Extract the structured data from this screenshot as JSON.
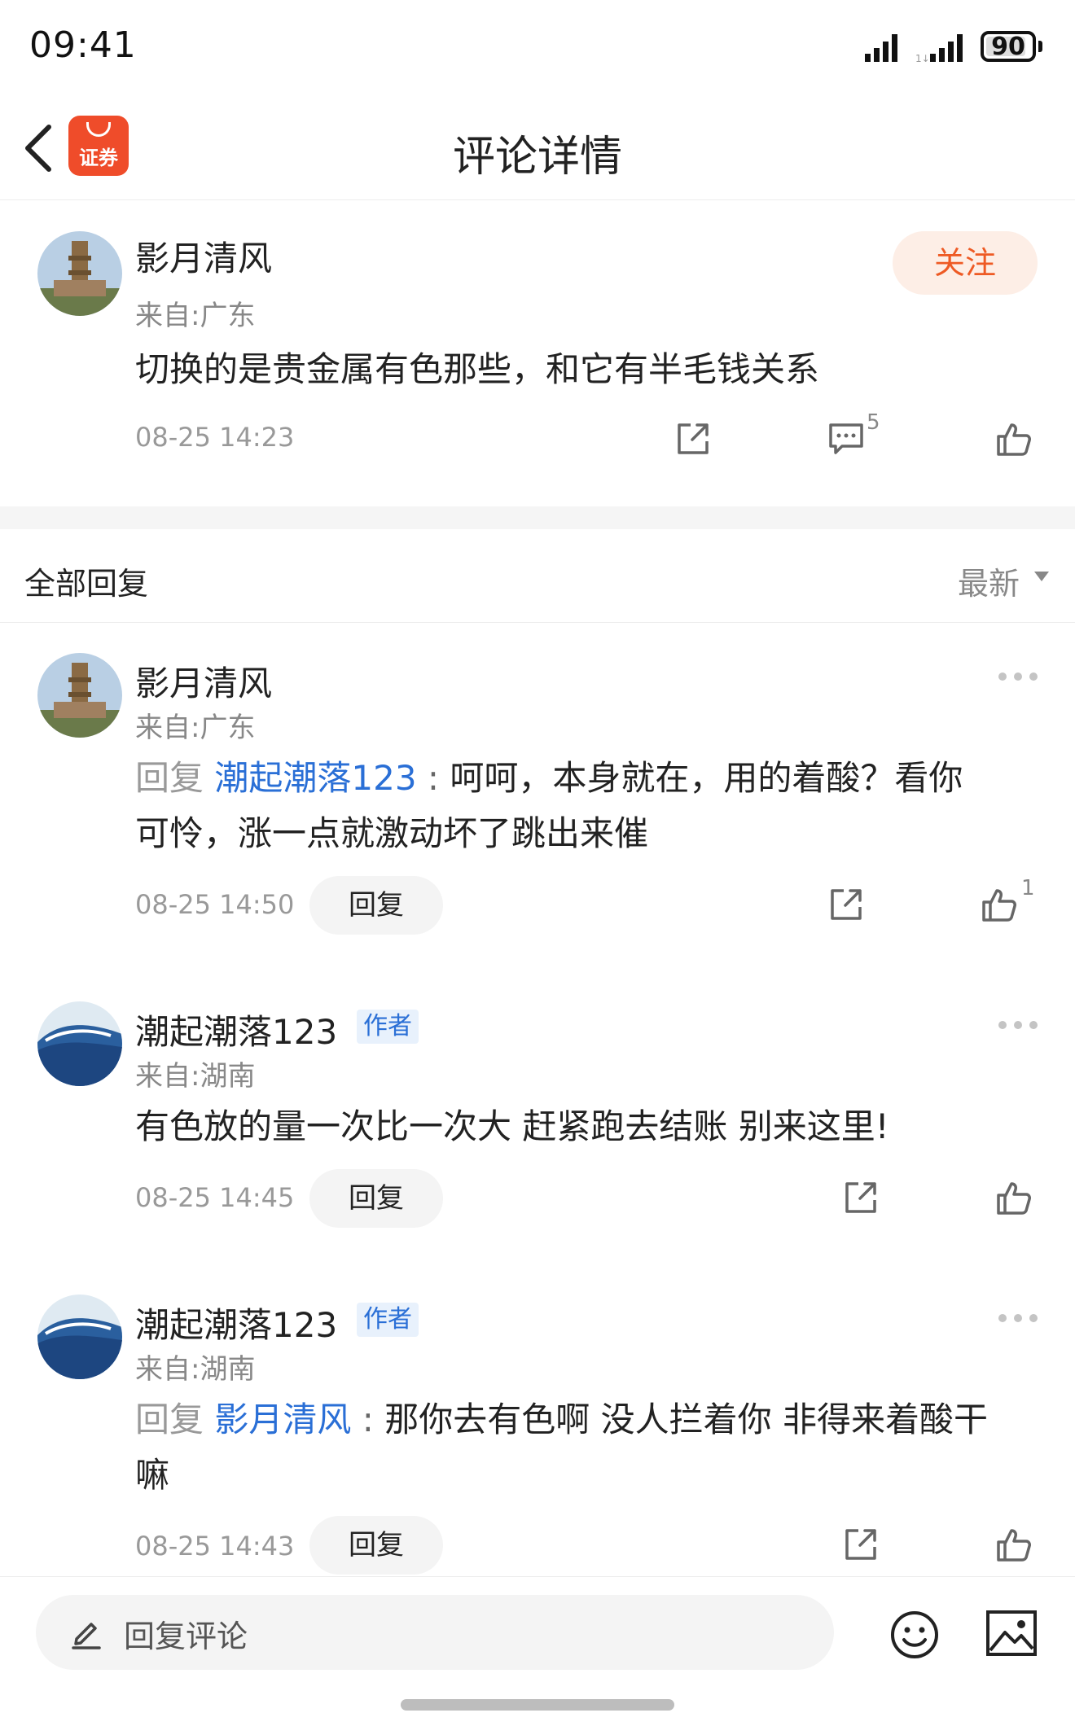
{
  "status_bar": {
    "time": "09:41",
    "battery": "90"
  },
  "nav": {
    "title": "评论详情",
    "app_logo_text": "证券"
  },
  "main_comment": {
    "username": "影月清风",
    "location": "来自:广东",
    "content": "切换的是贵金属有色那些，和它有半毛钱关系",
    "timestamp": "08-25 14:23",
    "comment_count": "5",
    "follow_label": "关注"
  },
  "replies_header": {
    "title": "全部回复",
    "sort_label": "最新"
  },
  "replies": [
    {
      "username": "影月清风",
      "location": "来自:广东",
      "reply_prefix": "回复",
      "mention": "潮起潮落123",
      "content_line1": "呵呵，本身就在，用的着酸？看你",
      "content_line2": "可怜，涨一点就激动坏了跳出来催",
      "timestamp": "08-25 14:50",
      "reply_label": "回复",
      "like_count": "1"
    },
    {
      "username": "潮起潮落123",
      "badge": "作者",
      "location": "来自:湖南",
      "content_line1": "有色放的量一次比一次大 赶紧跑去结账 别来这里!",
      "timestamp": "08-25 14:45",
      "reply_label": "回复"
    },
    {
      "username": "潮起潮落123",
      "badge": "作者",
      "location": "来自:湖南",
      "reply_prefix": "回复",
      "mention": "影月清风",
      "content_line1": "那你去有色啊 没人拦着你 非得来着酸干",
      "content_line2": "嘛",
      "timestamp": "08-25 14:43",
      "reply_label": "回复"
    }
  ],
  "bottom_bar": {
    "input_placeholder": "回复评论"
  },
  "colors": {
    "accent_orange": "#ee5a24",
    "link_blue": "#2a6fd6",
    "follow_bg": "#fdeee6"
  },
  "icons": [
    "back-icon",
    "share-icon",
    "comment-icon",
    "like-icon",
    "more-icon",
    "pencil-icon",
    "emoji-icon",
    "image-icon"
  ]
}
